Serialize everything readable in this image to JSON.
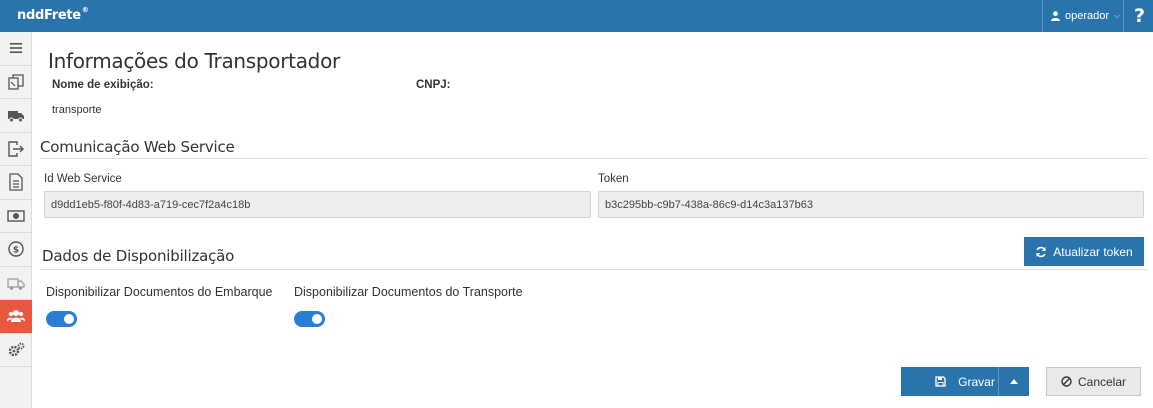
{
  "topbar": {
    "logo": "nddFrete",
    "logo_mark": "®",
    "user": "operador",
    "help": "?"
  },
  "sidebar": {
    "items": [
      {
        "icon": "menu-icon"
      },
      {
        "icon": "documents-icon"
      },
      {
        "icon": "truck-icon"
      },
      {
        "icon": "export-icon"
      },
      {
        "icon": "file-icon"
      },
      {
        "icon": "money-icon"
      },
      {
        "icon": "payment-cycle-icon"
      },
      {
        "icon": "delivery-truck-icon"
      },
      {
        "icon": "users-icon",
        "active": true
      },
      {
        "icon": "settings-icon"
      }
    ]
  },
  "page": {
    "title": "Informações do Transportador",
    "display_name_label": "Nome de exibição:",
    "display_name_value": "transporte",
    "cnpj_label": "CNPJ:",
    "cnpj_value": ""
  },
  "webservice": {
    "section_title": "Comunicação Web Service",
    "id_label": "Id Web Service",
    "id_value": "d9dd1eb5-f80f-4d83-a719-cec7f2a4c18b",
    "token_label": "Token",
    "token_value": "b3c295bb-c9b7-438a-86c9-d14c3a137b63",
    "refresh_button": "Atualizar token"
  },
  "availability": {
    "section_title": "Dados de Disponibilização",
    "toggle1_label": "Disponibilizar Documentos do Embarque",
    "toggle1_on": true,
    "toggle2_label": "Disponibilizar Documentos do Transporte",
    "toggle2_on": true
  },
  "footer": {
    "save_button": "Gravar",
    "cancel_button": "Cancelar"
  },
  "colors": {
    "primary": "#2a74ad",
    "active_sidebar": "#e8573f",
    "toggle": "#2a7fd4"
  }
}
